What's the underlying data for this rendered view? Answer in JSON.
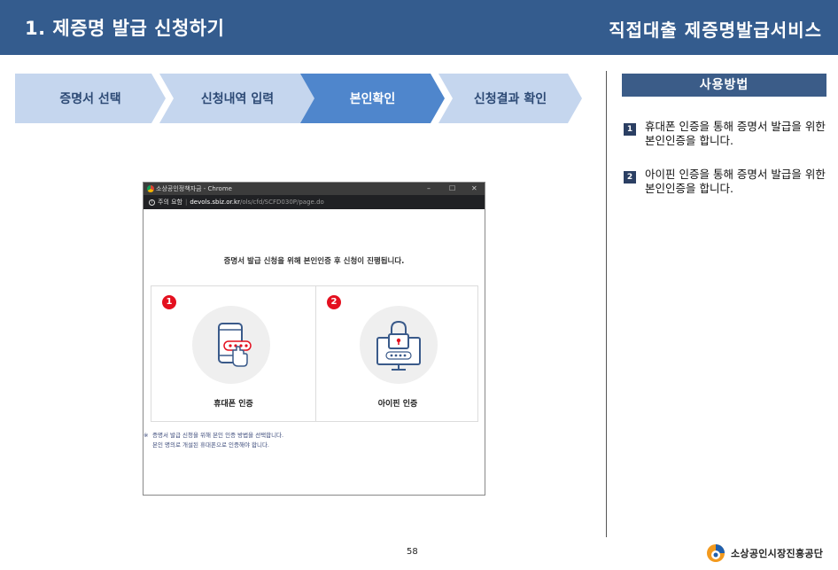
{
  "header": {
    "title": "1. 제증명 발급 신청하기",
    "subtitle": "직접대출 제증명발급서비스"
  },
  "steps": [
    {
      "label": "증명서 선택",
      "active": false
    },
    {
      "label": "신청내역 입력",
      "active": false
    },
    {
      "label": "본인확인",
      "active": true
    },
    {
      "label": "신청결과 확인",
      "active": false
    }
  ],
  "colors": {
    "header_bg": "#345c8e",
    "step_inactive": "#c5d6ee",
    "step_active": "#4f86cc",
    "badge_red": "#e4101f"
  },
  "usage": {
    "title": "사용방법",
    "items": [
      {
        "num": "1",
        "text": "휴대폰 인증을 통해 증명서 발급을 위한 본인인증을 합니다."
      },
      {
        "num": "2",
        "text": "아이핀 인증을 통해 증명서 발급을 위한 본인인증을 합니다."
      }
    ]
  },
  "browser": {
    "window_title": "소상공인정책자금 - Chrome",
    "controls": {
      "minimize": "–",
      "maximize": "☐",
      "close": "✕"
    },
    "address": {
      "warning": "주의 요함",
      "host": "devols.sbiz.or.kr",
      "path": "/ols/cfd/SCFD030P/page.do"
    },
    "heading": "증명서 발급 신청을 위해 본인인증 후 신청이 진행됩니다.",
    "options": [
      {
        "num": "1",
        "label": "휴대폰 인증",
        "icon": "smartphone-icon"
      },
      {
        "num": "2",
        "label": "아이핀 인증",
        "icon": "lock-monitor-icon"
      }
    ],
    "notes": {
      "mark": "※",
      "line1": "증명서 발급 신청을 위해 본인 인증 방법을 선택합니다.",
      "line2": "본인 명의로 개설된 휴대폰으로 인증해야 합니다."
    }
  },
  "footer": {
    "page_number": "58",
    "org_name": "소상공인시장진흥공단"
  }
}
